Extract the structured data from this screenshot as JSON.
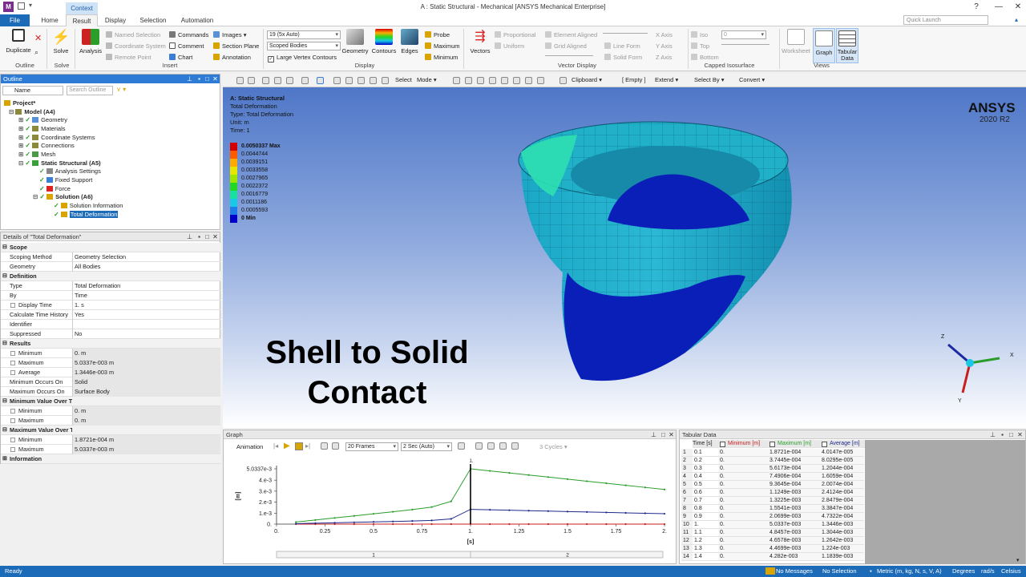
{
  "window": {
    "title": "A : Static Structural - Mechanical [ANSYS Mechanical Enterprise]",
    "context_label": "Context",
    "quick_launch_placeholder": "Quick Launch"
  },
  "tabs": [
    "File",
    "Home",
    "Result",
    "Display",
    "Selection",
    "Automation"
  ],
  "ribbon": {
    "duplicate": "Duplicate",
    "solve": "Solve",
    "analysis": "Analysis",
    "named_selection": "Named Selection",
    "coordinate_system": "Coordinate System",
    "remote_point": "Remote Point",
    "commands": "Commands",
    "comment": "Comment",
    "chart": "Chart",
    "images": "Images",
    "section_plane": "Section Plane",
    "annotation": "Annotation",
    "scale_combo": "19 (5x Auto)",
    "bodies_combo": "Scoped Bodies",
    "large_vertex": "Large Vertex Contours",
    "geometry": "Geometry",
    "contours": "Contours",
    "edges": "Edges",
    "probe": "Probe",
    "maximum": "Maximum",
    "minimum": "Minimum",
    "vectors": "Vectors",
    "proportional": "Proportional",
    "uniform": "Uniform",
    "element_aligned": "Element Aligned",
    "grid_aligned": "Grid Aligned",
    "line_form": "Line Form",
    "solid_form": "Solid Form",
    "x_axis": "X Axis",
    "y_axis": "Y Axis",
    "z_axis": "Z Axis",
    "iso": "Iso",
    "top": "Top",
    "bottom": "Bottom",
    "iso_value": "0",
    "worksheet": "Worksheet",
    "graph": "Graph",
    "tabular_data": "Tabular Data",
    "groups": {
      "outline": "Outline",
      "solve": "Solve",
      "insert": "Insert",
      "display": "Display",
      "vector_display": "Vector Display",
      "capped_isosurface": "Capped Isosurface",
      "views": "Views"
    }
  },
  "outline": {
    "header": "Outline",
    "name_label": "Name",
    "search_placeholder": "Search Outline",
    "items": [
      "Project*",
      "Model (A4)",
      "Geometry",
      "Materials",
      "Coordinate Systems",
      "Connections",
      "Mesh",
      "Static Structural (A5)",
      "Analysis Settings",
      "Fixed Support",
      "Force",
      "Solution (A6)",
      "Solution Information",
      "Total Deformation"
    ]
  },
  "details": {
    "header": "Details of \"Total Deformation\"",
    "rows": [
      {
        "k": "Scope",
        "v": ""
      },
      {
        "k": "Scoping Method",
        "v": "Geometry Selection"
      },
      {
        "k": "Geometry",
        "v": "All Bodies"
      },
      {
        "k": "Definition",
        "v": ""
      },
      {
        "k": "Type",
        "v": "Total Deformation"
      },
      {
        "k": "By",
        "v": "Time"
      },
      {
        "k": "Display Time",
        "v": "1. s"
      },
      {
        "k": "Calculate Time History",
        "v": "Yes"
      },
      {
        "k": "Identifier",
        "v": ""
      },
      {
        "k": "Suppressed",
        "v": "No"
      },
      {
        "k": "Results",
        "v": ""
      },
      {
        "k": "Minimum",
        "v": "0. m"
      },
      {
        "k": "Maximum",
        "v": "5.0337e-003 m"
      },
      {
        "k": "Average",
        "v": "1.3446e-003 m"
      },
      {
        "k": "Minimum Occurs On",
        "v": "Solid"
      },
      {
        "k": "Maximum Occurs On",
        "v": "Surface Body"
      },
      {
        "k": "Minimum Value Over Time",
        "v": ""
      },
      {
        "k": "Minimum",
        "v": "0. m"
      },
      {
        "k": "Maximum",
        "v": "0. m"
      },
      {
        "k": "Maximum Value Over Time",
        "v": ""
      },
      {
        "k": "Minimum",
        "v": "1.8721e-004 m"
      },
      {
        "k": "Maximum",
        "v": "5.0337e-003 m"
      },
      {
        "k": "Information",
        "v": ""
      }
    ]
  },
  "view_toolbar": {
    "select": "Select",
    "mode": "Mode",
    "clipboard": "Clipboard",
    "empty": "[ Empty ]",
    "extend": "Extend",
    "select_by": "Select By",
    "convert": "Convert"
  },
  "legend": {
    "title_lines": [
      "A: Static Structural",
      "Total Deformation",
      "Type: Total Deformation",
      "Unit: m",
      "Time: 1"
    ],
    "entries": [
      {
        "label": "0.0050337 Max",
        "color": "#d40000"
      },
      {
        "label": "0.0044744",
        "color": "#ff5a00"
      },
      {
        "label": "0.0039151",
        "color": "#ffaa00"
      },
      {
        "label": "0.0033558",
        "color": "#e6e600"
      },
      {
        "label": "0.0027965",
        "color": "#9ee600"
      },
      {
        "label": "0.0022372",
        "color": "#22d822"
      },
      {
        "label": "0.0016779",
        "color": "#18e0a0"
      },
      {
        "label": "0.0011186",
        "color": "#18c8e6"
      },
      {
        "label": "0.0005593",
        "color": "#1e7de6"
      },
      {
        "label": "0 Min",
        "color": "#0000c8"
      }
    ]
  },
  "brand": {
    "name": "ANSYS",
    "version": "2020 R2"
  },
  "overlay": {
    "line1": "Shell to Solid",
    "line2": "Contact"
  },
  "graph": {
    "header": "Graph",
    "animation": "Animation",
    "frames": "20 Frames",
    "duration": "2 Sec (Auto)",
    "cycles": "3 Cycles",
    "ylabel": "[m]",
    "xlabel": "[s]",
    "marker_label": "1.",
    "yticks": [
      "5.0337e-3",
      "4.e-3",
      "3.e-3",
      "2.e-3",
      "1.e-3",
      "0."
    ],
    "xticks": [
      "0.",
      "0.25",
      "0.5",
      "0.75",
      "1.",
      "1.25",
      "1.5",
      "1.75",
      "2."
    ],
    "step_labels": [
      "1",
      "2"
    ]
  },
  "tabular": {
    "header": "Tabular Data",
    "columns": [
      "Time [s]",
      "Minimum [m]",
      "Maximum [m]",
      "Average [m]"
    ],
    "rows": [
      [
        "1",
        "0.1",
        "0.",
        "1.8721e-004",
        "4.0147e-005"
      ],
      [
        "2",
        "0.2",
        "0.",
        "3.7445e-004",
        "8.0295e-005"
      ],
      [
        "3",
        "0.3",
        "0.",
        "5.6173e-004",
        "1.2044e-004"
      ],
      [
        "4",
        "0.4",
        "0.",
        "7.4906e-004",
        "1.6059e-004"
      ],
      [
        "5",
        "0.5",
        "0.",
        "9.3645e-004",
        "2.0074e-004"
      ],
      [
        "6",
        "0.6",
        "0.",
        "1.1249e-003",
        "2.4124e-004"
      ],
      [
        "7",
        "0.7",
        "0.",
        "1.3225e-003",
        "2.8479e-004"
      ],
      [
        "8",
        "0.8",
        "0.",
        "1.5541e-003",
        "3.3847e-004"
      ],
      [
        "9",
        "0.9",
        "0.",
        "2.0699e-003",
        "4.7322e-004"
      ],
      [
        "10",
        "1.",
        "0.",
        "5.0337e-003",
        "1.3446e-003"
      ],
      [
        "11",
        "1.1",
        "0.",
        "4.8457e-003",
        "1.3044e-003"
      ],
      [
        "12",
        "1.2",
        "0.",
        "4.6578e-003",
        "1.2642e-003"
      ],
      [
        "13",
        "1.3",
        "0.",
        "4.4699e-003",
        "1.224e-003"
      ],
      [
        "14",
        "1.4",
        "0.",
        "4.282e-003",
        "1.1839e-003"
      ]
    ]
  },
  "chart_data": {
    "type": "line",
    "xlabel": "[s]",
    "ylabel": "[m]",
    "xlim": [
      0,
      2
    ],
    "ylim": [
      0,
      0.0050337
    ],
    "x": [
      0.1,
      0.2,
      0.3,
      0.4,
      0.5,
      0.6,
      0.7,
      0.8,
      0.9,
      1.0,
      1.1,
      1.2,
      1.3,
      1.4,
      1.5,
      1.6,
      1.7,
      1.8,
      1.9,
      2.0
    ],
    "series": [
      {
        "name": "Minimum",
        "color": "#c81e1e",
        "values": [
          0,
          0,
          0,
          0,
          0,
          0,
          0,
          0,
          0,
          0,
          0,
          0,
          0,
          0,
          0,
          0,
          0,
          0,
          0,
          0
        ]
      },
      {
        "name": "Maximum",
        "color": "#2a9d2a",
        "values": [
          0.00018721,
          0.00037445,
          0.00056173,
          0.00074906,
          0.00093645,
          0.0011249,
          0.0013225,
          0.0015541,
          0.0020699,
          0.0050337,
          0.0048457,
          0.0046578,
          0.0044699,
          0.004282,
          0.004094,
          0.003906,
          0.003718,
          0.00353,
          0.003342,
          0.003154
        ]
      },
      {
        "name": "Average",
        "color": "#1e2a8c",
        "values": [
          4.0147e-05,
          8.0295e-05,
          0.00012044,
          0.00016059,
          0.00020074,
          0.00024124,
          0.00028479,
          0.00033847,
          0.00047322,
          0.0013446,
          0.0013044,
          0.0012642,
          0.001224,
          0.0011839,
          0.001144,
          0.001104,
          0.001064,
          0.001024,
          0.000984,
          0.000944
        ]
      }
    ]
  },
  "status": {
    "ready": "Ready",
    "messages": "No Messages",
    "selection": "No Selection",
    "units": "Metric (m, kg, N, s, V, A)",
    "degrees": "Degrees",
    "rads": "rad/s",
    "celsius": "Celsius"
  }
}
